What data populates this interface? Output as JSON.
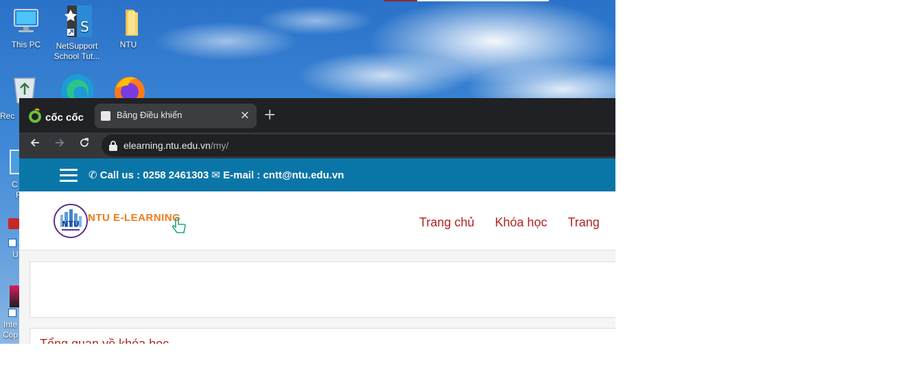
{
  "desktop": {
    "icons": [
      {
        "label": "This PC",
        "icon": "computer-icon"
      },
      {
        "label": "NetSupport School Tut...",
        "icon": "netsupport-icon"
      },
      {
        "label": "NTU",
        "icon": "folder-icon"
      }
    ],
    "side_fragments": [
      {
        "label": "Rec"
      },
      {
        "label": "C"
      },
      {
        "label": "F"
      },
      {
        "label": "U"
      },
      {
        "label": "Inte"
      },
      {
        "label": "Cop"
      }
    ]
  },
  "browser": {
    "brand": "cốc cốc",
    "tab": {
      "title": "Bảng Điều khiển",
      "close": "×"
    },
    "newtab": "+",
    "url_domain": "elearning.ntu.edu.vn",
    "url_path": "/my/"
  },
  "page": {
    "contact": {
      "call": "Call us : 0258 2461303",
      "email": "E-mail : cntt@ntu.edu.vn"
    },
    "logo_text": "NTU E-LEARNING",
    "logo_badge": "NTU",
    "nav": [
      "Trang chủ",
      "Khóa học",
      "Trang"
    ],
    "section_title": "Tổng quan về khóa học"
  },
  "colors": {
    "infobar": "#0a76a8",
    "nav_link": "#b22222",
    "logo_text": "#f07c1a"
  }
}
